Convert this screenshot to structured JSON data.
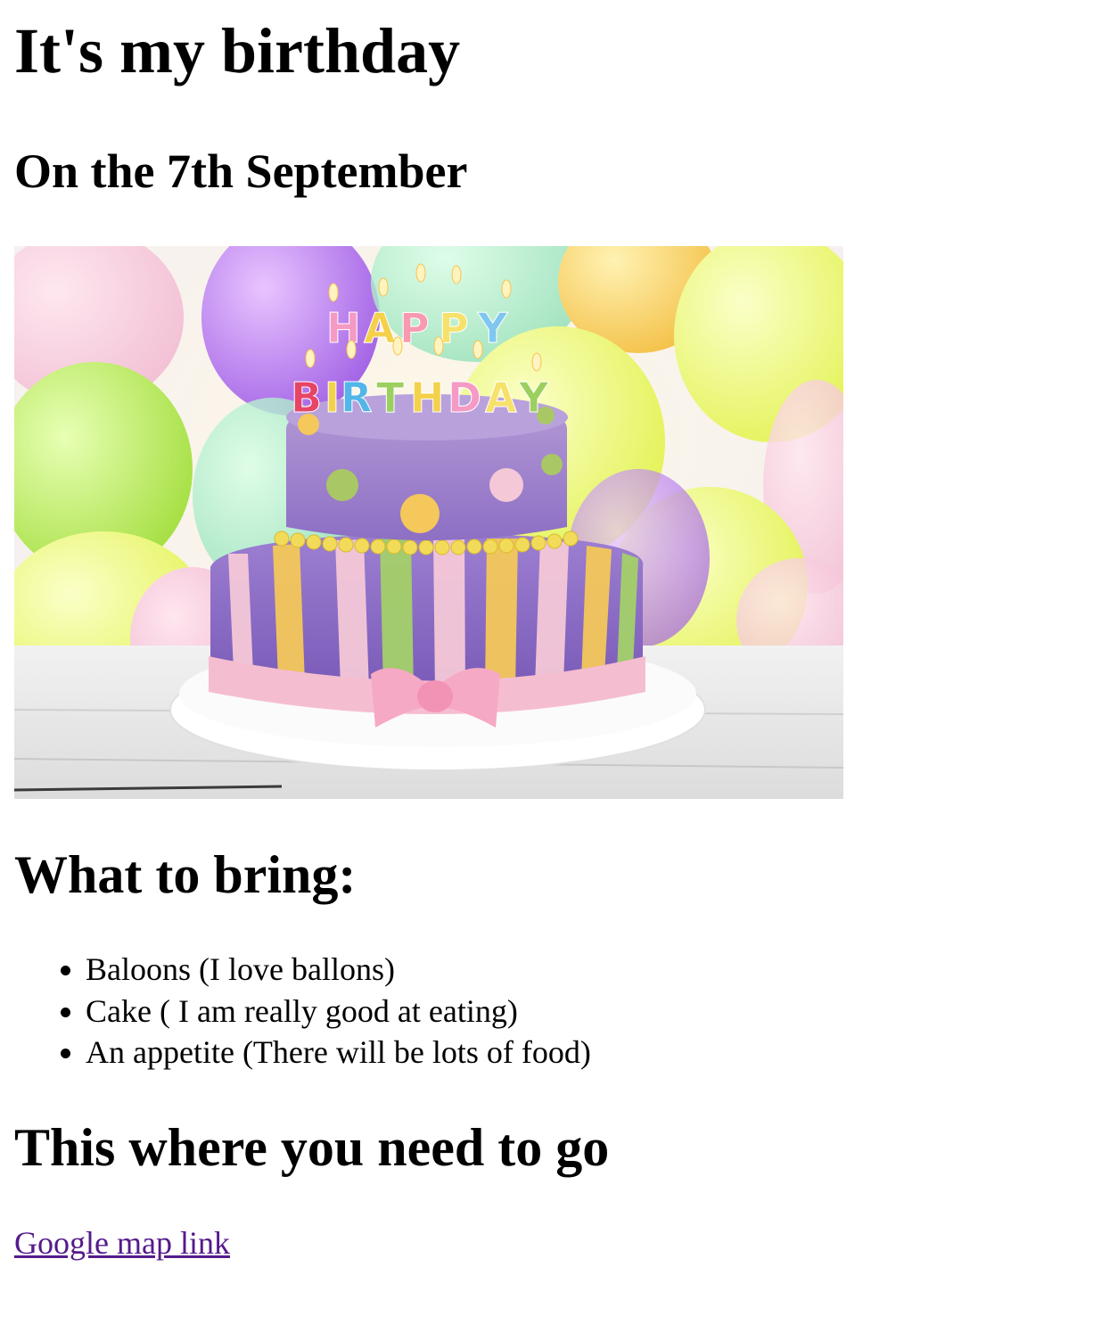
{
  "page": {
    "title": "It's my birthday",
    "subtitle": "On the 7th September",
    "image": {
      "subject": "birthday-cake",
      "candle_text": "HAPPY BIRTHDAY"
    },
    "bring": {
      "heading": "What to bring:",
      "items": [
        "Baloons (I love ballons)",
        "Cake ( I am really good at eating)",
        "An appetite (There will be lots of food)"
      ]
    },
    "directions": {
      "heading": "This where you need to go",
      "link_label": "Google map link"
    }
  },
  "colors": {
    "link_visited": "#551a8b",
    "text": "#000000",
    "background": "#ffffff"
  }
}
